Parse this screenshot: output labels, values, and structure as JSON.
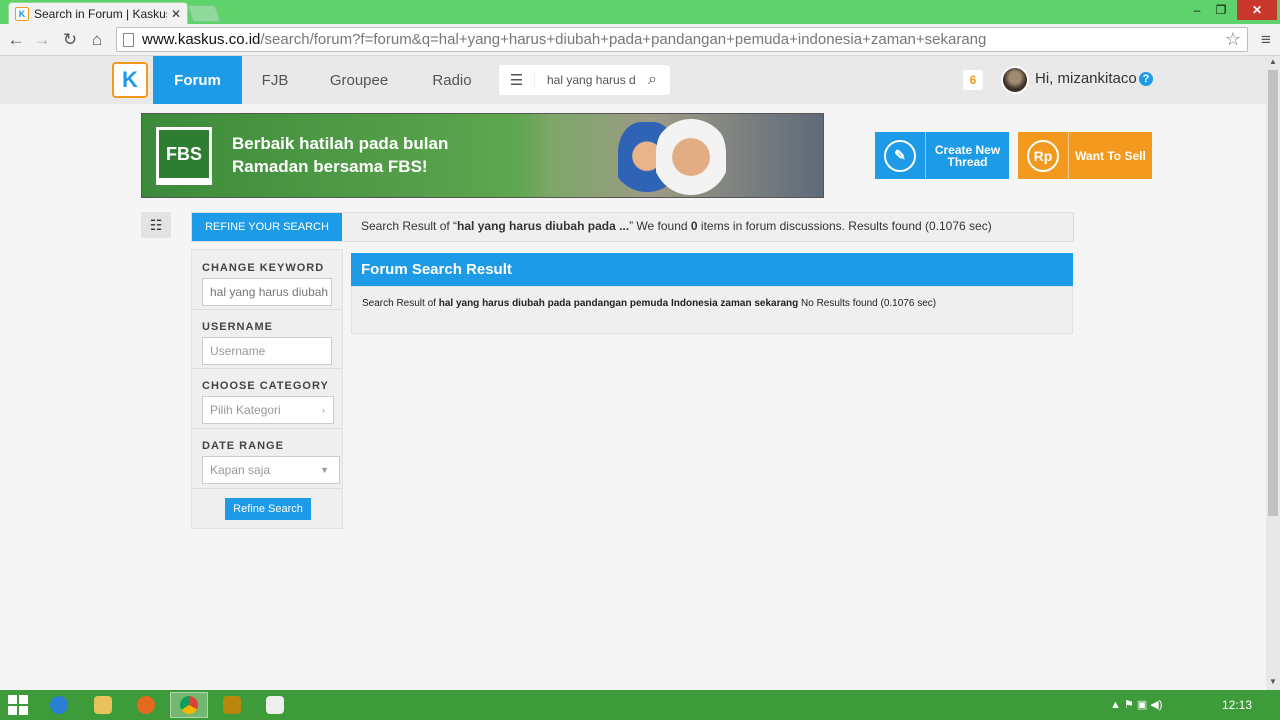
{
  "browser": {
    "tab_title": "Search in Forum | Kaskus",
    "tab_close": "✕",
    "url_host": "www.kaskus.co.id",
    "url_path": "/search/forum?f=forum&q=hal+yang+harus+diubah+pada+pandangan+pemuda+indonesia+zaman+sekarang",
    "window_min": "–",
    "window_max": "❐",
    "window_close": "✕"
  },
  "nav": {
    "logo_char": "K",
    "items": [
      {
        "label": "Forum",
        "active": true
      },
      {
        "label": "FJB"
      },
      {
        "label": "Groupee"
      },
      {
        "label": "Radio"
      }
    ],
    "search_query": "hal yang harus diubah",
    "notif_count": "6",
    "greeting": "Hi, mizankitaco",
    "help": "?"
  },
  "banner": {
    "logo": "FBS",
    "line1": "Berbaik hatilah pada bulan",
    "line2": "Ramadan bersama FBS!"
  },
  "actions": {
    "create_icon": "✎",
    "create_line1": "Create New",
    "create_line2": "Thread",
    "sell_icon": "Rp",
    "sell_label": "Want To Sell"
  },
  "refine": {
    "tab_label": "REFINE YOUR SEARCH",
    "summary_prefix": "Search Result of “",
    "summary_keyword": "hal yang harus diubah pada ...",
    "summary_mid": "” We found ",
    "summary_count": "0",
    "summary_suffix": " items in forum discussions. Results found (0.1076 sec)"
  },
  "sidebar": {
    "keyword_label": "CHANGE KEYWORD",
    "keyword_value": "hal yang harus diubah",
    "username_label": "USERNAME",
    "username_placeholder": "Username",
    "category_label": "CHOOSE CATEGORY",
    "category_value": "Pilih Kategori",
    "date_label": "DATE RANGE",
    "date_value": "Kapan saja",
    "refine_button": "Refine Search"
  },
  "results": {
    "heading": "Forum Search Result",
    "prefix": "Search Result of ",
    "keyword": "hal yang harus diubah pada pandangan pemuda Indonesia zaman sekarang",
    "suffix": " No Results found (0.1076 sec)"
  },
  "taskbar": {
    "clock": "12:13",
    "tray": "▲  ⚑  ▣  ◀)"
  },
  "colors": {
    "kaskus_blue": "#1d9be6",
    "kaskus_orange": "#f39a1e",
    "win_green": "#5fd36b"
  }
}
